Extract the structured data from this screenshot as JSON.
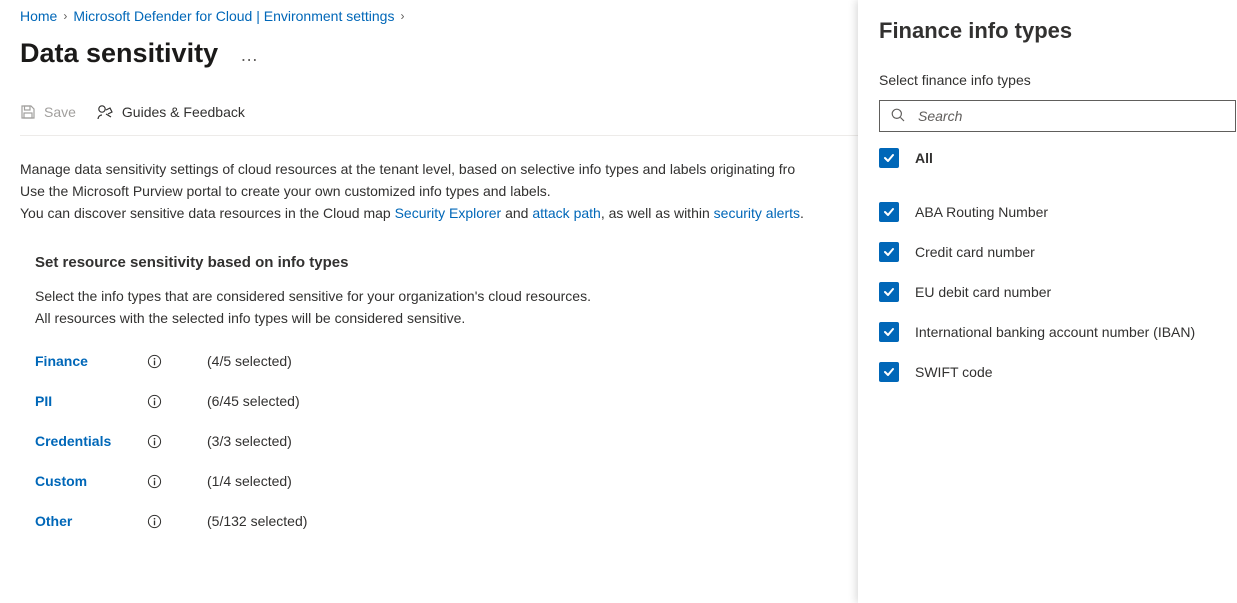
{
  "breadcrumb": {
    "home": "Home",
    "defender": "Microsoft Defender for Cloud | Environment settings"
  },
  "header": {
    "title": "Data sensitivity"
  },
  "toolbar": {
    "save": "Save",
    "guides": "Guides & Feedback"
  },
  "body": {
    "para1a": "Manage data sensitivity settings of cloud resources at the tenant level, based on selective info types and labels originating fro",
    "para1b": "Use the Microsoft Purview portal to create your own customized info types and labels.",
    "para2a": "You can discover sensitive data resources in the Cloud map ",
    "link_security_explorer": "Security Explorer",
    "para2b": " and ",
    "link_attack_path": "attack path",
    "para2c": ", as well as within ",
    "link_security_alerts": "security alerts",
    "para2d": "."
  },
  "section": {
    "title": "Set resource sensitivity based on info types",
    "sub1": "Select the info types that are considered sensitive for your organization's cloud resources.",
    "sub2": "All resources with the selected info types will be considered sensitive."
  },
  "categories": [
    {
      "name": "Finance",
      "count": "(4/5 selected)"
    },
    {
      "name": "PII",
      "count": "(6/45 selected)"
    },
    {
      "name": "Credentials",
      "count": "(3/3 selected)"
    },
    {
      "name": "Custom",
      "count": "(1/4 selected)"
    },
    {
      "name": "Other",
      "count": "(5/132 selected)"
    }
  ],
  "panel": {
    "title": "Finance info types",
    "subtitle": "Select finance info types",
    "search_placeholder": "Search",
    "all": "All",
    "items": [
      "ABA Routing Number",
      "Credit card number",
      "EU debit card number",
      "International banking account number (IBAN)",
      "SWIFT code"
    ]
  }
}
